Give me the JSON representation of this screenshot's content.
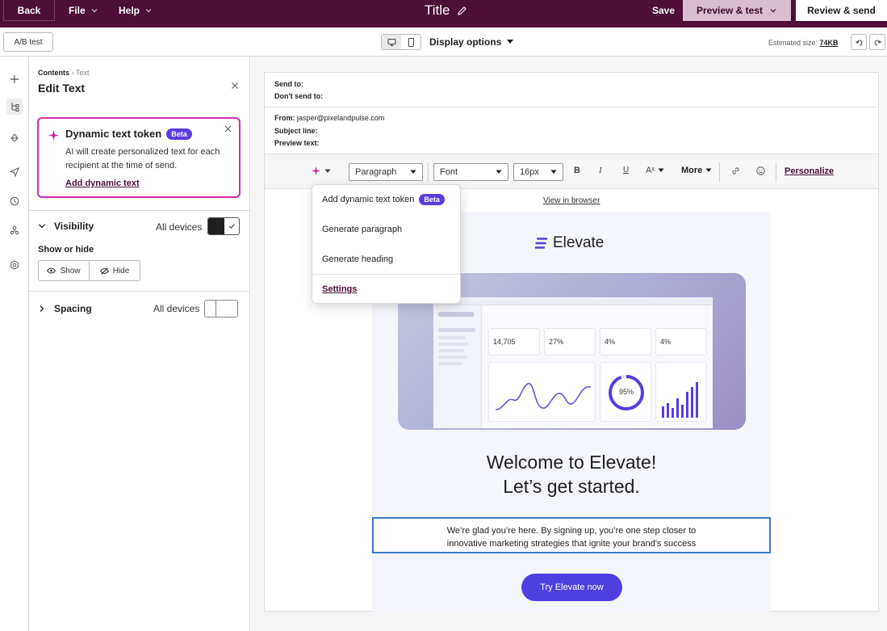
{
  "topbar": {
    "back_label": "Back",
    "file_label": "File",
    "help_label": "Help",
    "title": "Title",
    "save_label": "Save",
    "preview_label": "Preview & test",
    "review_label": "Review & send"
  },
  "subbar": {
    "ab_test_label": "A/B test",
    "display_options_label": "Display options",
    "estimated_size_label": "Estimated size:",
    "estimated_size_value": "74KB"
  },
  "panel": {
    "breadcrumb_root": "Contents",
    "breadcrumb_current": "Text",
    "title": "Edit Text",
    "token_card": {
      "title": "Dynamic text token",
      "badge": "Beta",
      "description": "AI will create personalized text for each recipient at the time of send.",
      "link_label": "Add dynamic text"
    },
    "visibility": {
      "label": "Visibility",
      "devices_label": "All devices",
      "show_or_hide_label": "Show or hide",
      "show_label": "Show",
      "hide_label": "Hide"
    },
    "spacing": {
      "label": "Spacing",
      "devices_label": "All devices"
    }
  },
  "editor": {
    "send_to_label": "Send to:",
    "dont_send_to_label": "Don't send to:",
    "from_label": "From:",
    "from_value": "jasper@pixelandpulse.com",
    "subject_label": "Subject line:",
    "preview_text_label": "Preview text:",
    "toolbar": {
      "paragraph_value": "Paragraph",
      "font_value": "Font",
      "size_value": "16px",
      "bold_label": "B",
      "italic_label": "I",
      "underline_label": "U",
      "text_style_label": "Aˣ",
      "more_label": "More",
      "personalize_label": "Personalize"
    }
  },
  "menu": {
    "items": [
      {
        "label": "Add dynamic text token",
        "badge": "Beta"
      },
      {
        "label": "Generate paragraph"
      },
      {
        "label": "Generate heading"
      },
      {
        "label": "Settings"
      }
    ]
  },
  "email": {
    "view_in_browser": "View in browser",
    "brand_name": "Elevate",
    "heading_line1": "Welcome to Elevate!",
    "heading_line2": "Let’s get started.",
    "paragraph_line1": "We’re glad you’re here. By signing up, you’re one step closer to",
    "paragraph_line2": "innovative marketing strategies that ignite your brand's success",
    "cta_label": "Try Elevate now",
    "dashboard": {
      "stat1": "14,705",
      "stat2": "27%",
      "stat3": "4%",
      "stat4": "4%",
      "gauge": "95%"
    }
  },
  "colors": {
    "topbar_bg": "#4d0f35",
    "accent_pink": "#d22bb0",
    "beta_purple": "#5b3be0",
    "cta_blue": "#4f3fe0",
    "selection_blue": "#3f78c9"
  }
}
